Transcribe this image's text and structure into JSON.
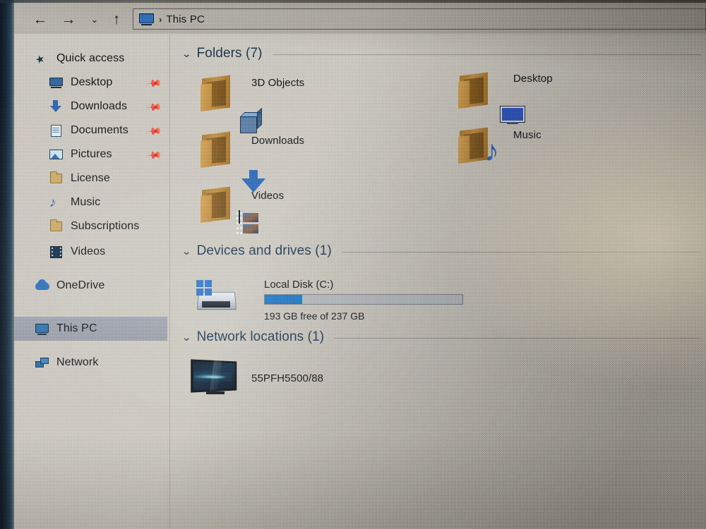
{
  "window": {
    "title": "This PC"
  },
  "toolbar": {
    "back_icon": "back-arrow-icon",
    "back_glyph": "←",
    "forward_icon": "forward-arrow-icon",
    "forward_glyph": "→",
    "recent_icon": "recent-locations-chevron-icon",
    "recent_glyph": "⌄",
    "up_icon": "up-arrow-icon",
    "up_glyph": "↑",
    "address": {
      "pc_icon": "this-pc-icon",
      "separator": "›",
      "path_text": "This PC"
    }
  },
  "sidebar": {
    "items": [
      {
        "label": "Quick access",
        "icon": "pin-star-icon",
        "level": 0,
        "pinned": false,
        "selected": false
      },
      {
        "label": "Desktop",
        "icon": "desktop-icon",
        "level": 1,
        "pinned": true,
        "selected": false
      },
      {
        "label": "Downloads",
        "icon": "downloads-icon",
        "level": 1,
        "pinned": true,
        "selected": false
      },
      {
        "label": "Documents",
        "icon": "documents-icon",
        "level": 1,
        "pinned": true,
        "selected": false
      },
      {
        "label": "Pictures",
        "icon": "pictures-icon",
        "level": 1,
        "pinned": true,
        "selected": false
      },
      {
        "label": "License",
        "icon": "folder-icon",
        "level": 1,
        "pinned": false,
        "selected": false
      },
      {
        "label": "Music",
        "icon": "music-note-icon",
        "level": 1,
        "pinned": false,
        "selected": false
      },
      {
        "label": "Subscriptions",
        "icon": "folder-icon",
        "level": 1,
        "pinned": false,
        "selected": false
      },
      {
        "label": "Videos",
        "icon": "film-strip-icon",
        "level": 1,
        "pinned": false,
        "selected": false
      },
      {
        "label": "OneDrive",
        "icon": "cloud-icon",
        "level": 0,
        "pinned": false,
        "selected": false
      },
      {
        "label": "This PC",
        "icon": "this-pc-icon",
        "level": 0,
        "pinned": false,
        "selected": true
      },
      {
        "label": "Network",
        "icon": "network-icon",
        "level": 0,
        "pinned": false,
        "selected": false
      }
    ],
    "pin_glyph": "📌"
  },
  "content": {
    "groups": [
      {
        "title": "Folders (7)",
        "chevron": "⌄",
        "expanded": true
      },
      {
        "title": "Devices and drives (1)",
        "chevron": "⌄",
        "expanded": true
      },
      {
        "title": "Network locations (1)",
        "chevron": "⌄",
        "expanded": true
      }
    ],
    "folders": [
      {
        "label": "3D Objects",
        "icon": "folder-3d-objects-icon"
      },
      {
        "label": "Desktop",
        "icon": "folder-desktop-icon"
      },
      {
        "label": "Downloads",
        "icon": "folder-downloads-icon"
      },
      {
        "label": "Music",
        "icon": "folder-music-icon"
      },
      {
        "label": "Videos",
        "icon": "folder-videos-icon"
      }
    ],
    "drives": [
      {
        "name": "Local Disk (C:)",
        "icon": "local-disk-icon",
        "free_text": "193 GB free of 237 GB",
        "free_gb": 193,
        "total_gb": 237,
        "used_percent": 19,
        "bar_fill_color": "#1673c4",
        "bar_track_color": "#b0b6be"
      }
    ],
    "network_locations": [
      {
        "label": "55PFH5500/88",
        "icon": "network-tv-icon"
      }
    ]
  }
}
